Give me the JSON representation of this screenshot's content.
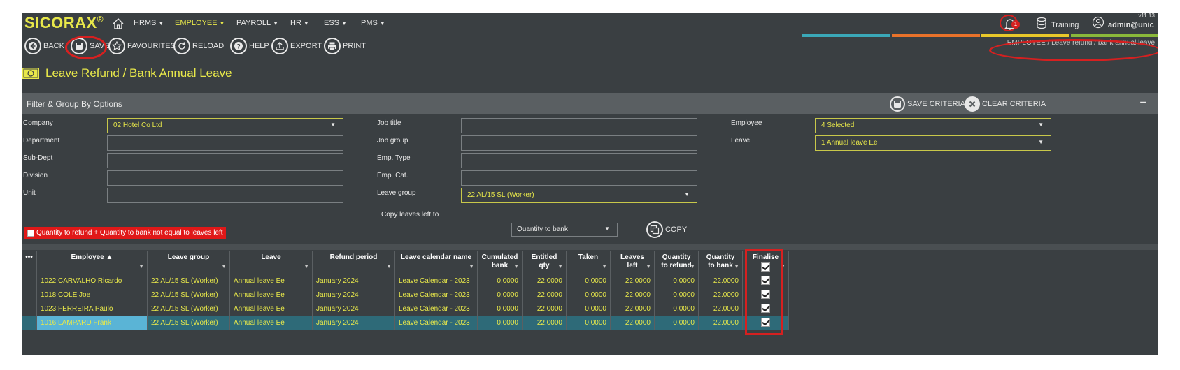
{
  "app": {
    "logo": "SICORAX",
    "logo_mark": "®",
    "version": "v11.13."
  },
  "nav": [
    {
      "label": "HRMS",
      "active": false
    },
    {
      "label": "EMPLOYEE",
      "active": true
    },
    {
      "label": "PAYROLL",
      "active": false
    },
    {
      "label": "HR",
      "active": false
    },
    {
      "label": "ESS",
      "active": false
    },
    {
      "label": "PMS",
      "active": false
    }
  ],
  "topbar": {
    "notification_count": "1",
    "env_label": "Training",
    "user_label": "admin@unic"
  },
  "toolbar": {
    "back": "BACK",
    "save": "SAVE",
    "favourites": "FAVOURITES",
    "reload": "RELOAD",
    "help": "HELP",
    "export": "EXPORT",
    "print": "PRINT"
  },
  "breadcrumb": {
    "parent": "EMPLOYEE",
    "sep": "/",
    "current": "Leave refund / bank annual leave"
  },
  "page": {
    "title": "Leave Refund / Bank Annual Leave"
  },
  "filter": {
    "title": "Filter & Group By Options",
    "save_criteria": "SAVE CRITERIA",
    "clear_criteria": "CLEAR CRITERIA",
    "collapse": "−",
    "col1": [
      {
        "label": "Company",
        "value": "02 Hotel Co Ltd",
        "select": true
      },
      {
        "label": "Department",
        "value": "",
        "select": false
      },
      {
        "label": "Sub-Dept",
        "value": "",
        "select": false
      },
      {
        "label": "Division",
        "value": "",
        "select": false
      },
      {
        "label": "Unit",
        "value": "",
        "select": false
      }
    ],
    "col2": [
      {
        "label": "Job title",
        "value": "",
        "select": false
      },
      {
        "label": "Job group",
        "value": "",
        "select": false
      },
      {
        "label": "Emp. Type",
        "value": "",
        "select": false
      },
      {
        "label": "Emp. Cat.",
        "value": "",
        "select": false
      },
      {
        "label": "Leave group",
        "value": "22 AL/15 SL (Worker)",
        "select": true
      }
    ],
    "col3": [
      {
        "label": "Employee",
        "value": "4 Selected",
        "select": true
      },
      {
        "label": "Leave",
        "value": "1 Annual leave Ee",
        "select": true
      }
    ],
    "warning": "Quantity to refund + Quantity to bank not equal to leaves left",
    "copy_label": "Copy leaves left to",
    "copy_value": "Quantity to bank",
    "copy_button": "COPY"
  },
  "grid": {
    "menu": "•••",
    "headers": [
      {
        "l1": "Employee ▲",
        "l2": ""
      },
      {
        "l1": "Leave group",
        "l2": ""
      },
      {
        "l1": "Leave",
        "l2": ""
      },
      {
        "l1": "Refund period",
        "l2": ""
      },
      {
        "l1": "Leave calendar name",
        "l2": ""
      },
      {
        "l1": "Cumulated",
        "l2": "bank"
      },
      {
        "l1": "Entitled",
        "l2": "qty"
      },
      {
        "l1": "Taken",
        "l2": ""
      },
      {
        "l1": "Leaves",
        "l2": "left"
      },
      {
        "l1": "Quantity",
        "l2": "to refund"
      },
      {
        "l1": "Quantity",
        "l2": "to bank"
      },
      {
        "l1": "Finalise",
        "l2": ""
      }
    ],
    "rows": [
      [
        "1022 CARVALHO Ricardo",
        "22 AL/15 SL (Worker)",
        "Annual leave Ee",
        "January 2024",
        "Leave Calendar - 2023",
        "0.0000",
        "22.0000",
        "0.0000",
        "22.0000",
        "0.0000",
        "22.0000"
      ],
      [
        "1018 COLE Joe",
        "22 AL/15 SL (Worker)",
        "Annual leave Ee",
        "January 2024",
        "Leave Calendar - 2023",
        "0.0000",
        "22.0000",
        "0.0000",
        "22.0000",
        "0.0000",
        "22.0000"
      ],
      [
        "1023 FERREIRA Paulo",
        "22 AL/15 SL (Worker)",
        "Annual leave Ee",
        "January 2024",
        "Leave Calendar - 2023",
        "0.0000",
        "22.0000",
        "0.0000",
        "22.0000",
        "0.0000",
        "22.0000"
      ],
      [
        "1016 LAMPARD Frank",
        "22 AL/15 SL (Worker)",
        "Annual leave Ee",
        "January 2024",
        "Leave Calendar - 2023",
        "0.0000",
        "22.0000",
        "0.0000",
        "22.0000",
        "0.0000",
        "22.0000"
      ]
    ],
    "selected_row": 3
  },
  "colors": {
    "accent": "#e8e84a",
    "background": "#3a3f42",
    "alert": "#d62020",
    "selected_row": "#2e6a78"
  }
}
